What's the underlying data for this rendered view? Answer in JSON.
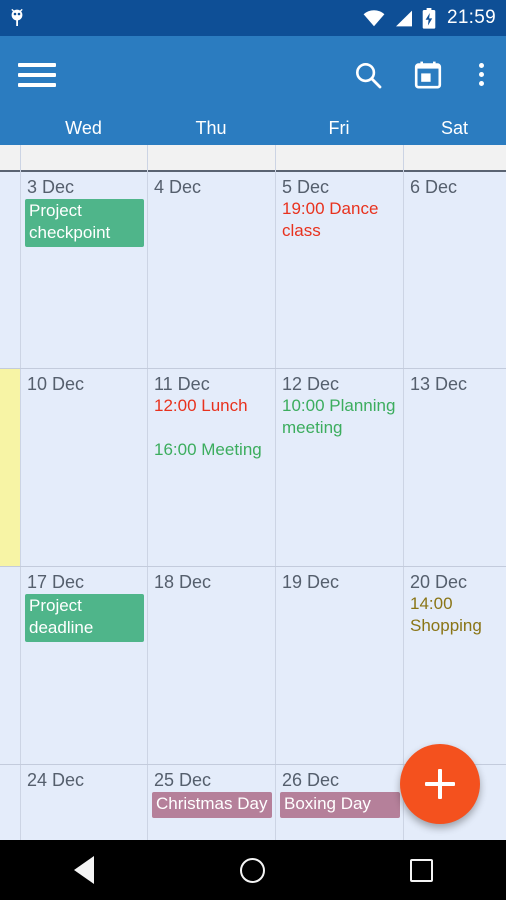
{
  "status_bar": {
    "time": "21:59",
    "icons": [
      "app-notification-icon",
      "wifi-icon",
      "cellular-signal-icon",
      "battery-charging-icon"
    ]
  },
  "app_bar": {
    "menu_icon": "hamburger-menu-icon",
    "actions": [
      {
        "name": "search-icon",
        "label": "Search"
      },
      {
        "name": "today-calendar-icon",
        "label": "Go to today"
      },
      {
        "name": "overflow-menu-icon",
        "label": "More options"
      }
    ]
  },
  "weekdays": [
    {
      "label": "Wed"
    },
    {
      "label": "Thu"
    },
    {
      "label": "Fri"
    },
    {
      "label": "Sat"
    }
  ],
  "colors": {
    "status_bar": "#0e4f96",
    "app_bar": "#2b7cc0",
    "cell_background": "#e4ecfa",
    "today_week_marker": "#f7f4a5",
    "event_green_block": "#4fb58a",
    "event_mauve_block": "#b5809a",
    "event_red_text": "#e8321e",
    "event_green_text": "#3cad5e",
    "event_olive_text": "#8a7516",
    "fab": "#f4511e",
    "grid_line": "#c3cbdc",
    "nav_bar": "#000000"
  },
  "weeks": [
    {
      "week_marker": "gray",
      "partial": true,
      "days": [
        {
          "date": "",
          "events": []
        },
        {
          "date": "",
          "events": []
        },
        {
          "date": "",
          "events": []
        },
        {
          "date": "",
          "events": []
        }
      ]
    },
    {
      "week_marker": "none",
      "partial": false,
      "days": [
        {
          "date": "3 Dec",
          "events": [
            {
              "title": "Project checkpoint",
              "style": "block",
              "color": "green"
            }
          ]
        },
        {
          "date": "4 Dec",
          "events": []
        },
        {
          "date": "5 Dec",
          "events": [
            {
              "title": "19:00 Dance class",
              "style": "text",
              "color": "red"
            }
          ]
        },
        {
          "date": "6 Dec",
          "events": []
        }
      ]
    },
    {
      "week_marker": "today",
      "partial": false,
      "days": [
        {
          "date": "10 Dec",
          "events": []
        },
        {
          "date": "11 Dec",
          "events": [
            {
              "title": "12:00 Lunch",
              "style": "text",
              "color": "red"
            },
            {
              "title": "",
              "style": "spacer",
              "color": ""
            },
            {
              "title": "16:00 Meeting",
              "style": "text",
              "color": "green"
            }
          ]
        },
        {
          "date": "12 Dec",
          "events": [
            {
              "title": "10:00 Planning meeting",
              "style": "text",
              "color": "green"
            }
          ]
        },
        {
          "date": "13 Dec",
          "events": []
        }
      ]
    },
    {
      "week_marker": "none",
      "partial": false,
      "days": [
        {
          "date": "17 Dec",
          "events": [
            {
              "title": "Project deadline",
              "style": "block",
              "color": "green"
            }
          ]
        },
        {
          "date": "18 Dec",
          "events": []
        },
        {
          "date": "19 Dec",
          "events": []
        },
        {
          "date": "20 Dec",
          "events": [
            {
              "title": "14:00 Shopping",
              "style": "text",
              "color": "olive"
            }
          ]
        }
      ]
    },
    {
      "week_marker": "none",
      "partial": true,
      "days": [
        {
          "date": "24 Dec",
          "events": []
        },
        {
          "date": "25 Dec",
          "events": [
            {
              "title": "Christmas Day",
              "style": "block",
              "color": "mauve"
            }
          ]
        },
        {
          "date": "26 Dec",
          "events": [
            {
              "title": "Boxing Day",
              "style": "block",
              "color": "mauve"
            }
          ]
        },
        {
          "date": "",
          "events": []
        }
      ]
    }
  ],
  "fab": {
    "name": "add-event-fab",
    "label": "+"
  },
  "nav_bar": {
    "buttons": [
      {
        "name": "nav-back-button",
        "label": "Back"
      },
      {
        "name": "nav-home-button",
        "label": "Home"
      },
      {
        "name": "nav-recents-button",
        "label": "Recents"
      }
    ]
  }
}
